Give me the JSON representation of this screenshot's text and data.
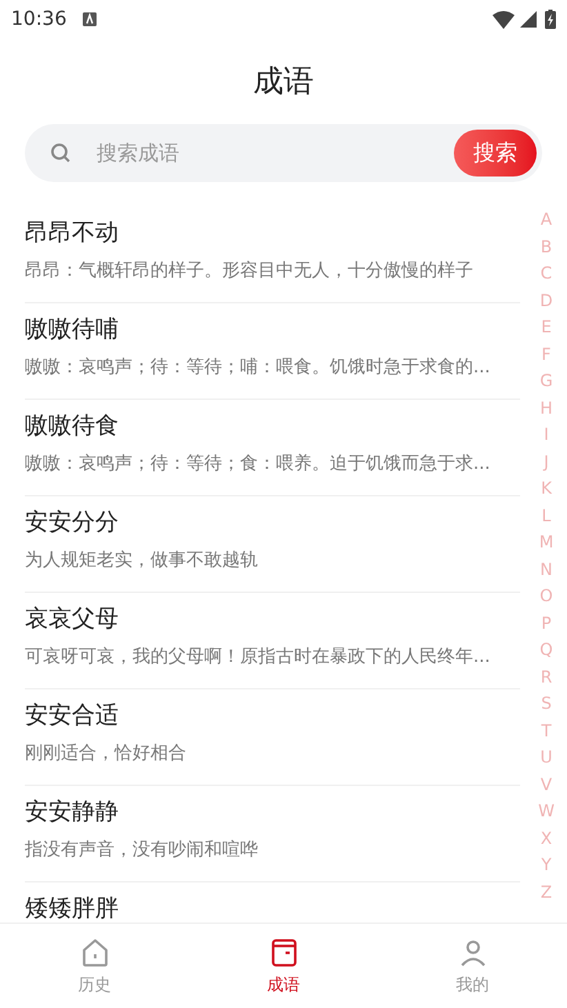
{
  "status_bar": {
    "time": "10:36"
  },
  "title": "成语",
  "search": {
    "placeholder": "搜索成语",
    "button": "搜索"
  },
  "idioms": [
    {
      "title": "昂昂不动",
      "meaning": "昂昂：气概轩昂的样子。形容目中无人，十分傲慢的样子"
    },
    {
      "title": "嗷嗷待哺",
      "meaning": "嗷嗷：哀鸣声；待：等待；哺：喂食。饥饿时急于求食的..."
    },
    {
      "title": "嗷嗷待食",
      "meaning": "嗷嗷：哀鸣声；待：等待；食：喂养。迫于饥饿而急于求..."
    },
    {
      "title": "安安分分",
      "meaning": "为人规矩老实，做事不敢越轨"
    },
    {
      "title": "哀哀父母",
      "meaning": "可哀呀可哀，我的父母啊！原指古时在暴政下的人民终年..."
    },
    {
      "title": "安安合适",
      "meaning": "刚刚适合，恰好相合"
    },
    {
      "title": "安安静静",
      "meaning": "指没有声音，没有吵闹和喧哗"
    },
    {
      "title": "矮矮胖胖"
    }
  ],
  "index_letters": [
    "A",
    "B",
    "C",
    "D",
    "E",
    "F",
    "G",
    "H",
    "I",
    "J",
    "K",
    "L",
    "M",
    "N",
    "O",
    "P",
    "Q",
    "R",
    "S",
    "T",
    "U",
    "V",
    "W",
    "X",
    "Y",
    "Z"
  ],
  "tabs": [
    {
      "label": "历史",
      "kind": "history",
      "selected": false
    },
    {
      "label": "成语",
      "kind": "idiom",
      "selected": true
    },
    {
      "label": "我的",
      "kind": "profile",
      "selected": false
    }
  ]
}
